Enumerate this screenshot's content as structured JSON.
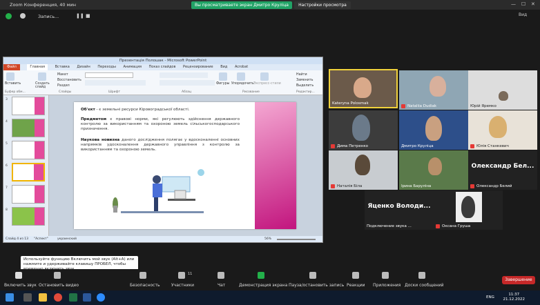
{
  "zoom": {
    "window_title": "Zoom Конференция, 40 мин",
    "share_banner": "Вы просматриваете экран Дмитро Круліца",
    "view_options": "Настройки просмотра",
    "recording_label": "Запись...",
    "view_button": "Вид"
  },
  "ppt": {
    "title": "Презентація Полошак - Microsoft PowerPoint",
    "tabs": [
      "Файл",
      "Главная",
      "Вставка",
      "Дизайн",
      "Переходы",
      "Анимация",
      "Показ слайдов",
      "Рецензирование",
      "Вид",
      "Acrobat"
    ],
    "ribbon": {
      "paste": "Вставить",
      "new_slide": "Создать слайд",
      "layout": "Макет",
      "reset": "Восстановить",
      "section": "Раздел",
      "shapes": "Фигуры",
      "arrange": "Упорядочить",
      "quick_styles": "Экспресс-стили",
      "find": "Найти",
      "replace": "Заменить",
      "select": "Выделить",
      "group_clipboard": "Буфер обм...",
      "group_slides": "Слайды",
      "group_font": "Шрифт",
      "group_paragraph": "Абзац",
      "group_drawing": "Рисование",
      "group_editing": "Редактир..."
    },
    "slide_numbers": [
      "3",
      "4",
      "5",
      "6",
      "7",
      "8"
    ],
    "slide": {
      "object_label": "Об'єкт",
      "object_text": " - є земельні ресурси Кіровоградської області.",
      "subject_label": "Предметом",
      "subject_text": " є правові норми, які регулюють здійснення державного контролю за використанням та охороною земель сільськогосподарського призначення.",
      "novelty_label": "Наукова новизна",
      "novelty_text": " даного дослідження полягає у вдосконаленні основних напрямків удосконалення державного управління з контролю за використанням та охороною земель."
    },
    "status": {
      "slide_counter": "Слайд 4 из 13",
      "theme": "\"Аспект\"",
      "language": "украинский",
      "zoom": "56%"
    }
  },
  "participants": [
    {
      "name": "Kateryna Polosmak",
      "muted": false
    },
    {
      "name": "Nataliia Dudiak",
      "muted": true
    },
    {
      "name": "Юрій Яремко",
      "muted": false
    },
    {
      "name": "Дима Петренко",
      "muted": true
    },
    {
      "name": "Дмитро Круліца",
      "muted": false
    },
    {
      "name": "Юлія Станкевич",
      "muted": true
    },
    {
      "name": "Наталія Біла",
      "muted": true
    },
    {
      "name": "Ірина Баруліна",
      "muted": false
    },
    {
      "name": "Олександр Белий",
      "muted": true,
      "big": "Олександр Бел..."
    },
    {
      "name": "Подключение звука ...",
      "muted": false,
      "big": "Яценко Володи..."
    },
    {
      "name": "Оксана Груша",
      "muted": true
    }
  ],
  "tooltip": "Используйте функцию Включить мой звук (Alt+A) или нажмите и удерживайте клавишу ПРОБЕЛ, чтобы временно включить звук.",
  "toolbar": {
    "unmute": "Включить звук",
    "start_video": "Остановить видео",
    "security": "Безопасность",
    "participants": "Участники",
    "participants_count": "11",
    "chat": "Чат",
    "share": "Демонстрация экрана",
    "pause_rec": "Пауза/остановить запись",
    "reactions": "Реакции",
    "apps": "Приложения",
    "whiteboards": "Доски сообщений",
    "end": "Завершение"
  },
  "taskbar": {
    "lang": "ENG",
    "time": "11:37",
    "date": "21.12.2022"
  },
  "colors": {
    "accent_green": "#21a366",
    "end_red": "#c62828",
    "active_speaker": "#f2d33b",
    "slide_pink": "#c2157e"
  }
}
